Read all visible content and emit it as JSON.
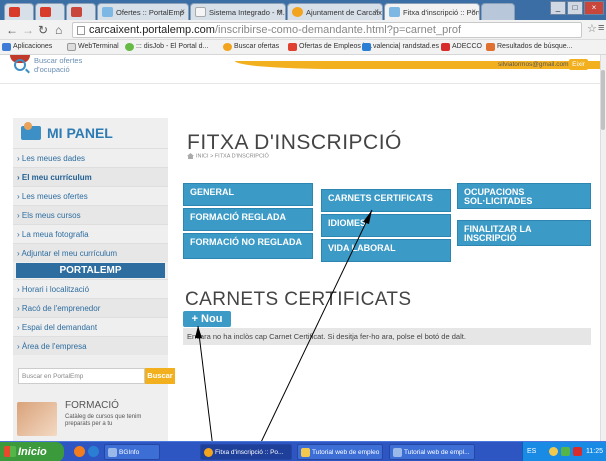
{
  "browser": {
    "tabs": [
      {
        "label": "",
        "fav_color": "#d93b2a"
      },
      {
        "label": "",
        "fav_color": "#d93b2a"
      },
      {
        "label": "",
        "fav_color": "#c9463d"
      },
      {
        "label": "Ofertes :: PortalEmp",
        "fav_color": "#7db7e3"
      },
      {
        "label": "Sistema Integrado - M.I.A",
        "fav_color": "#f5f5f5"
      },
      {
        "label": "Ajuntament de Carcaixent",
        "fav_color": "#f2a41e"
      },
      {
        "label": "Fitxa d'inscripció :: PortalE",
        "fav_color": "#7db7e3"
      }
    ],
    "url_host": "carcaixent.portalemp.com",
    "url_path": "/inscribirse-como-demandante.html?p=carnet_prof",
    "bookmarks": [
      {
        "label": "Aplicaciones",
        "color": "#3d7bd6"
      },
      {
        "label": "WebTerminal",
        "color": "#dddddd"
      },
      {
        "label": "::: disJob - El Portal d...",
        "color": "#66bb44"
      },
      {
        "label": "Buscar ofertas",
        "color": "#f2a41e"
      },
      {
        "label": "Ofertas de Empleos | ...",
        "color": "#e0402f"
      },
      {
        "label": "valencia| randstad.es",
        "color": "#2a7fd4"
      },
      {
        "label": "ADECCO",
        "color": "#d82c2c"
      },
      {
        "label": "Resultados de búsque...",
        "color": "#e0702f"
      }
    ]
  },
  "header": {
    "search_offers": "Buscar ofertes d'ocupació",
    "email": "silviatormos@gmail.com",
    "exit_label": "Eixir"
  },
  "sidebar": {
    "panel_title": "MI PANEL",
    "items": [
      "Les meues dades",
      "El meu currículum",
      "Les meues ofertes",
      "Els meus cursos",
      "La meua fotografia",
      "Adjuntar el meu currículum"
    ],
    "portal_title": "PORTALEMP",
    "portal_items": [
      "Horari i localització",
      "Racó de l'emprenedor",
      "Espai del demandant",
      "Àrea de l'empresa"
    ],
    "search_placeholder": "Buscar en PortalEmp",
    "search_button": "Buscar",
    "promo_title": "FORMACIÓ",
    "promo_desc": "Catàleg de cursos que tenim preparats per a tu"
  },
  "main": {
    "title": "FITXA D'INSCRIPCIÓ",
    "breadcrumb_home": "INICI",
    "breadcrumb_current": "> FITXA D'INSCRIPCIÓ",
    "buttons": [
      "GENERAL",
      "FORMACIÓ REGLADA",
      "FORMACIÓ NO REGLADA",
      "CARNETS CERTIFICATS",
      "IDIOMES",
      "VIDA LABORAL",
      "OCUPACIONS SOL·LICITADES",
      "FINALITZAR LA INSCRIPCIÓ"
    ],
    "section_title": "CARNETS CERTIFICATS",
    "new_button": "+ Nou",
    "notice": "Encara no ha inclòs cap Carnet Certificat. Si desitja fer-ho ara, polse el botó de dalt."
  },
  "taskbar": {
    "start": "Inicio",
    "tasks": [
      {
        "label": "BGInfo",
        "color": "#9bb9e8"
      },
      {
        "label": "Fitxa d'inscripció :: Po...",
        "color": "#f2a41e"
      },
      {
        "label": "Tutorial web de empleo",
        "color": "#f2c94c"
      },
      {
        "label": "Tutorial web de empl...",
        "color": "#9bb9e8"
      }
    ],
    "lang": "ES",
    "time": "11:25"
  }
}
